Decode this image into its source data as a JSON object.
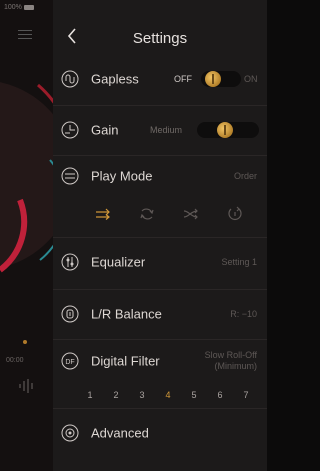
{
  "statusbar": {
    "battery": "100%"
  },
  "player": {
    "time": "00:00"
  },
  "header": {
    "title": "Settings"
  },
  "gapless": {
    "label": "Gapless",
    "off": "OFF",
    "on": "ON"
  },
  "gain": {
    "label": "Gain",
    "value": "Medium"
  },
  "playmode": {
    "label": "Play Mode",
    "value": "Order"
  },
  "equalizer": {
    "label": "Equalizer",
    "value": "Setting 1"
  },
  "balance": {
    "label": "L/R Balance",
    "value": "R: −10"
  },
  "filter": {
    "label": "Digital Filter",
    "value_line1": "Slow Roll-Off",
    "value_line2": "(Minimum)",
    "options": [
      "1",
      "2",
      "3",
      "4",
      "5",
      "6",
      "7"
    ],
    "selected": "4"
  },
  "advanced": {
    "label": "Advanced"
  },
  "colors": {
    "accent": "#d39a3a",
    "panel": "#1c1a1a"
  }
}
